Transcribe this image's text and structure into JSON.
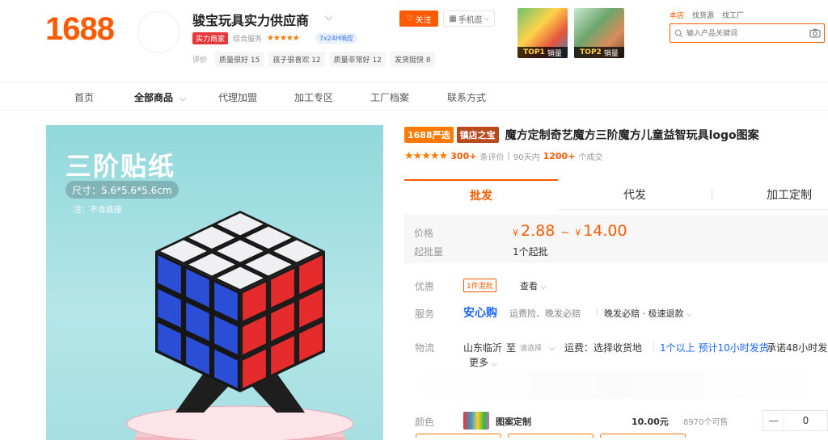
{
  "header": {
    "logo": "1688",
    "shop_name": "骏宝玩具实力供应商",
    "badge_strength": "实力商家",
    "badge_service": "综合服务",
    "stars": "★★★★★",
    "badge_247": "7x24H响应",
    "ratings_label": "评价",
    "ratings": [
      "质量很好 15",
      "孩子很喜欢 12",
      "质量非常好 12",
      "发货挺快 8"
    ],
    "follow_label": "关注",
    "mobile_label": "手机逛",
    "top_products": [
      {
        "rank": "TOP1",
        "label": "销量"
      },
      {
        "rank": "TOP2",
        "label": "销量"
      }
    ],
    "search_tabs": [
      "本店",
      "找货源",
      "找工厂"
    ],
    "search_placeholder": "输入产品关键词"
  },
  "nav": {
    "items": [
      "首页",
      "全部商品",
      "代理加盟",
      "加工专区",
      "工厂档案",
      "联系方式"
    ]
  },
  "image": {
    "title": "三阶贴纸",
    "size": "尺寸：5.6*5.6*5.6cm",
    "note": "注：不含底座"
  },
  "product": {
    "tag_yanxuan": "1688严选",
    "tag_zhenbao": "镇店之宝",
    "title": "魔方定制奇艺魔方三阶魔方儿童益智玩具logo图案",
    "stars": "★★★★★",
    "reviews_count": "300+",
    "reviews_label": "条评价",
    "period": "90天内",
    "sold_count": "1200+",
    "sold_label": "个成交"
  },
  "tabs": [
    "批发",
    "代发",
    "加工定制"
  ],
  "price": {
    "label": "价格",
    "currency": "¥",
    "low": "2.88",
    "sep": "~",
    "high": "14.00",
    "moq_label": "起批量",
    "moq_value": "1个起批"
  },
  "promo": {
    "label": "优惠",
    "tag": "1件混批",
    "view": "查看"
  },
  "service": {
    "label": "服务",
    "brand": "安心购",
    "items": "运费险、晚发必赔",
    "items2": "晚发必赔 · 极速退款"
  },
  "logistics": {
    "label": "物流",
    "from": "山东临沂",
    "to": "至",
    "select": "请选择",
    "fee": "运费：选择收货地",
    "time": "1个以上  预计10小时发货",
    "promise": "承诺48小时发",
    "more": "更多"
  },
  "sku": {
    "label": "颜色",
    "name": "图案定制",
    "price": "10.00元",
    "stock": "8970个可售",
    "minus": "—",
    "qty": "0"
  }
}
